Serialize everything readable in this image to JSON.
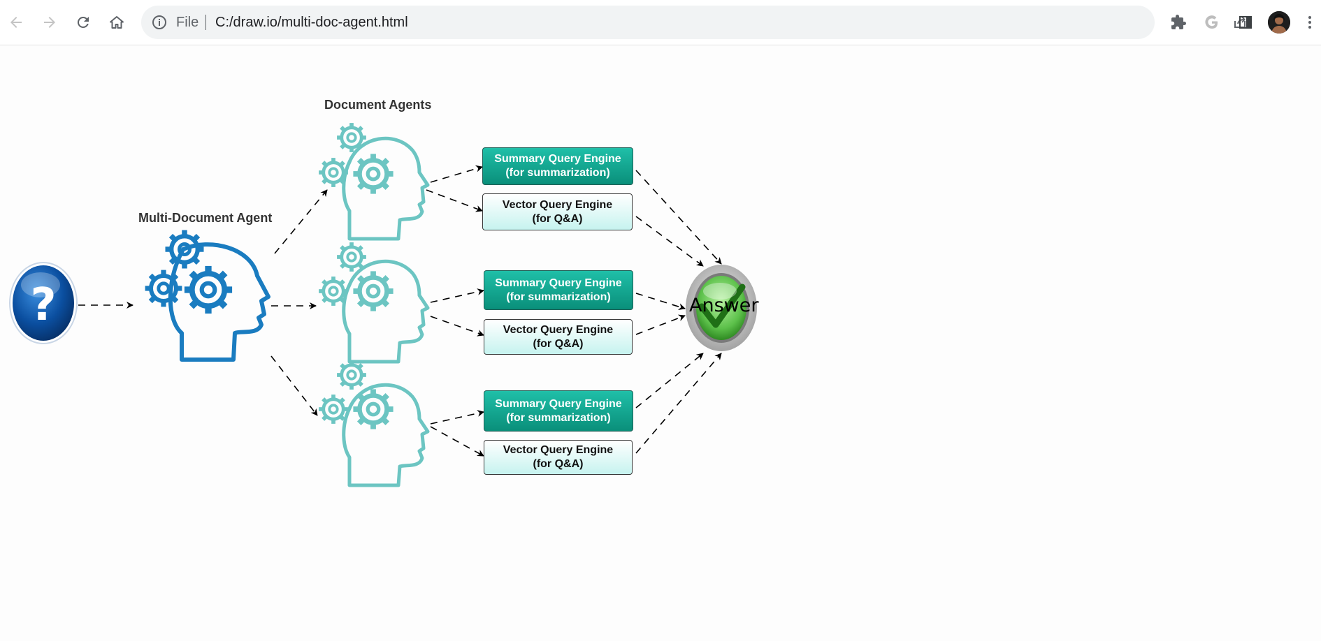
{
  "browser": {
    "omnibox": {
      "scheme_label": "File",
      "url": "C:/draw.io/multi-doc-agent.html"
    },
    "icons": [
      "back-icon",
      "forward-icon",
      "reload-icon",
      "home-icon",
      "info-icon",
      "share-icon",
      "star-icon",
      "extensions-icon",
      "google-icon",
      "side-panel-icon",
      "profile-avatar",
      "menu-icon"
    ]
  },
  "diagram": {
    "multi_agent_label": "Multi-Document Agent",
    "document_agents_label": "Document Agents",
    "engines": [
      {
        "summary_line1": "Summary Query Engine",
        "summary_line2": "(for summarization)",
        "vector_line1": "Vector Query Engine",
        "vector_line2": "(for Q&A)"
      },
      {
        "summary_line1": "Summary Query Engine",
        "summary_line2": "(for summarization)",
        "vector_line1": "Vector Query Engine",
        "vector_line2": "(for Q&A)"
      },
      {
        "summary_line1": "Summary Query Engine",
        "summary_line2": "(for summarization)",
        "vector_line1": "Vector Query Engine",
        "vector_line2": "(for Q&A)"
      }
    ],
    "answer_label": "Answer",
    "question_glyph": "?",
    "colors": {
      "multi_agent": "#1a7cc0",
      "doc_agent": "#6cc5c2",
      "summary_box": "#12a890",
      "vector_box": "#dff8f6",
      "question": "#0b4fa0",
      "answer": "#5cc04a"
    }
  }
}
